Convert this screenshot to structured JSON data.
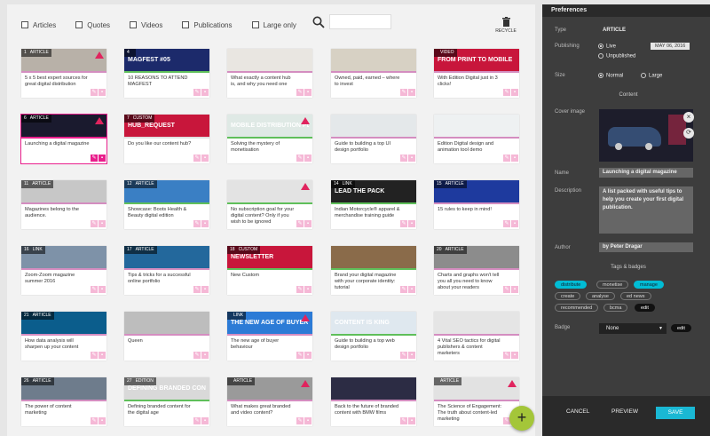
{
  "filters": [
    "Articles",
    "Quotes",
    "Videos",
    "Publications",
    "Large only"
  ],
  "search": {
    "placeholder": ""
  },
  "recycle_label": "RECYCLE",
  "cards": [
    {
      "num": "1",
      "type": "ARTICLE",
      "title": "5 x 5 best expert sources for great digital distribution",
      "thumb": "",
      "bg": "#b8b1a8",
      "bar": "#d48dc0",
      "triangle": true
    },
    {
      "num": "4",
      "type": "",
      "title": "10 REASONS TO ATTEND MAGFEST",
      "thumb": "MAGFEST #05",
      "bg": "#1c2a6b",
      "bar": "#5fbf5a",
      "triangle": false
    },
    {
      "num": "",
      "type": "",
      "title": "What exactly a content hub is, and why you need one",
      "thumb": "",
      "bg": "#e9e6e1",
      "bar": "#d48dc0",
      "triangle": false
    },
    {
      "num": "",
      "type": "",
      "title": "Owned, paid, earned – where to invest",
      "thumb": "",
      "bg": "#d7d1c4",
      "bar": "#d48dc0",
      "triangle": false
    },
    {
      "num": "",
      "type": "VIDEO",
      "title": "With Edition Digital just in 3 clicks!",
      "thumb": "FROM PRINT TO MOBILE",
      "bg": "#c8163b",
      "bar": "#d48dc0",
      "triangle": false
    },
    {
      "num": "6",
      "type": "ARTICLE",
      "title": "Launching a digital magazine",
      "thumb": "",
      "bg": "#1a1a2e",
      "bar": "#e91e8c",
      "triangle": true,
      "selected": true
    },
    {
      "num": "7",
      "type": "CUSTOM",
      "title": "Do you like our content hub?",
      "thumb": "HUB_REQUEST",
      "bg": "#c8163b",
      "bar": "#e0e0e0",
      "triangle": false
    },
    {
      "num": "",
      "type": "",
      "title": "Solving the mystery of monetisation",
      "thumb": "MOBILE DISTRIBUTION PLATFORMS",
      "bg": "#dfe9e5",
      "bar": "#5fbf5a",
      "triangle": true
    },
    {
      "num": "",
      "type": "",
      "title": "Guide to building a top UI design portfolio",
      "thumb": "",
      "bg": "#e4e8ea",
      "bar": "#d48dc0",
      "triangle": false
    },
    {
      "num": "",
      "type": "",
      "title": "Edition Digital design and animation tool demo",
      "thumb": "",
      "bg": "#eef1f2",
      "bar": "#d48dc0",
      "triangle": false
    },
    {
      "num": "11",
      "type": "ARTICLE",
      "title": "Magazines belong to the audience.",
      "thumb": "",
      "bg": "#c7c7c7",
      "bar": "#d48dc0",
      "triangle": false
    },
    {
      "num": "12",
      "type": "ARTICLE",
      "title": "Showcase: Boots Health & Beauty digital edition",
      "thumb": "",
      "bg": "#3a7fc4",
      "bar": "#5fbf5a",
      "triangle": false
    },
    {
      "num": "",
      "type": "",
      "title": "No subscription goal for your digital content? Only if you wish to be ignored",
      "thumb": "",
      "bg": "#e3e3e3",
      "bar": "#5fbf5a",
      "triangle": true
    },
    {
      "num": "14",
      "type": "LINK",
      "title": "Indian Motorcycle® apparel & merchandise training guide",
      "thumb": "LEAD THE PACK",
      "bg": "#222222",
      "bar": "#5fbf5a",
      "triangle": false
    },
    {
      "num": "15",
      "type": "ARTICLE",
      "title": "15 rules to keep in mind!",
      "thumb": "",
      "bg": "#1e3a9e",
      "bar": "#d48dc0",
      "triangle": false
    },
    {
      "num": "16",
      "type": "LINK",
      "title": "Zoom-Zoom magazine summer 2016",
      "thumb": "",
      "bg": "#7e92a8",
      "bar": "#d48dc0",
      "triangle": false
    },
    {
      "num": "17",
      "type": "ARTICLE",
      "title": "Tips & tricks for a successful online portfolio",
      "thumb": "",
      "bg": "#23689c",
      "bar": "#d48dc0",
      "triangle": false
    },
    {
      "num": "18",
      "type": "CUSTOM",
      "title": "New Custom",
      "thumb": "NEWSLETTER",
      "bg": "#c8163b",
      "bar": "#5fbf5a",
      "triangle": false
    },
    {
      "num": "",
      "type": "",
      "title": "Brand your digital magazine with your corporate identity: tutorial",
      "thumb": "",
      "bg": "#8a6b4a",
      "bar": "#5fbf5a",
      "triangle": false
    },
    {
      "num": "20",
      "type": "ARTICLE",
      "title": "Charts and graphs won't tell you all you need to know about your readers",
      "thumb": "",
      "bg": "#8c8c8c",
      "bar": "#d48dc0",
      "triangle": false
    },
    {
      "num": "21",
      "type": "ARTICLE",
      "title": "How data analysis will sharpen up your content",
      "thumb": "",
      "bg": "#0b5d8c",
      "bar": "#d48dc0",
      "triangle": false
    },
    {
      "num": "",
      "type": "",
      "title": "Queen",
      "thumb": "",
      "bg": "#bdbdbd",
      "bar": "#d48dc0",
      "triangle": false
    },
    {
      "num": "",
      "type": "LINK",
      "title": "The new age of buyer behaviour",
      "thumb": "THE NEW AGE OF BUYER BEHAVIOR:",
      "bg": "#2c7bd6",
      "bar": "#d48dc0",
      "triangle": true
    },
    {
      "num": "",
      "type": "",
      "title": "Guide to building a top web design portfolio",
      "thumb": "CONTENT IS KING",
      "bg": "#dfe8ef",
      "bar": "#5fbf5a",
      "triangle": false
    },
    {
      "num": "",
      "type": "",
      "title": "4 Vital SEO tactics for digital publishers & content marketers",
      "thumb": "",
      "bg": "#e5e5e5",
      "bar": "#d48dc0",
      "triangle": false
    },
    {
      "num": "26",
      "type": "ARTICLE",
      "title": "The power of content marketing",
      "thumb": "",
      "bg": "#6e7c8c",
      "bar": "#d48dc0",
      "triangle": false
    },
    {
      "num": "27",
      "type": "EDITION",
      "title": "Defining branded content for the digital age",
      "thumb": "DEFINING BRANDED CONTENT FOR THE",
      "bg": "#d9d9d9",
      "bar": "#5fbf5a",
      "triangle": false
    },
    {
      "num": "",
      "type": "ARTICLE",
      "title": "What makes great branded and video content?",
      "thumb": "",
      "bg": "#9a9a9a",
      "bar": "#d48dc0",
      "triangle": true
    },
    {
      "num": "",
      "type": "",
      "title": "Back to the future of branded content with BMW films",
      "thumb": "",
      "bg": "#2c2c44",
      "bar": "#d48dc0",
      "triangle": false
    },
    {
      "num": "",
      "type": "ARTICLE",
      "title": "The Science of Engagement: The truth about content-led marketing",
      "thumb": "",
      "bg": "#e2e2e2",
      "bar": "#d48dc0",
      "triangle": true
    }
  ],
  "panel": {
    "title": "Preferences",
    "type_label": "Type",
    "type_value": "ARTICLE",
    "publishing_label": "Publishing",
    "live": "Live",
    "unpublished": "Unpublished",
    "date": "MAY 06, 2016",
    "size_label": "Size",
    "normal": "Normal",
    "large": "Large",
    "content_heading": "Content",
    "cover_label": "Cover image",
    "name_label": "Name",
    "name_value": "Launching a digital magazine",
    "description_label": "Description",
    "description_value": "A list packed with useful tips to help you create your first digital publication.",
    "author_label": "Author",
    "author_value": "by Peter Dragar",
    "tags_heading": "Tags & badges",
    "tags": [
      "distribute",
      "monetise",
      "manage",
      "create",
      "analyse",
      "ed news",
      "recommended",
      "bcma",
      "edit"
    ],
    "badge_label": "Badge",
    "badge_value": "None",
    "badge_edit": "edit",
    "cancel": "CANCEL",
    "preview": "PREVIEW",
    "save": "SAVE"
  }
}
